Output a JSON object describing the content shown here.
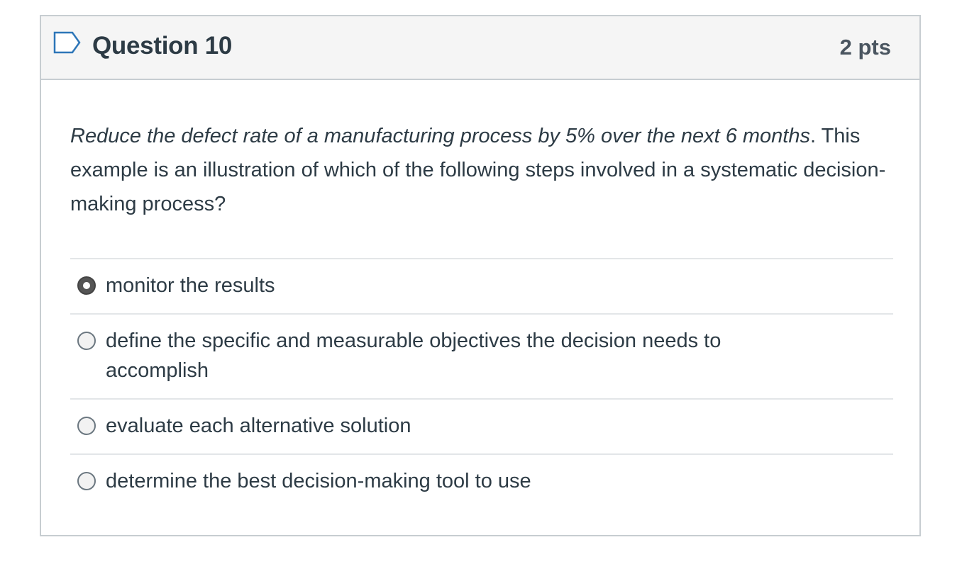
{
  "question": {
    "title": "Question 10",
    "points": "2 pts",
    "text_italic": "Reduce the defect rate of a manufacturing process by 5% over the next 6 months",
    "text_rest": ". This example is an illustration of which of the following steps involved in a systematic decision-making process?"
  },
  "icons": {
    "flag": "flag-outline-icon"
  },
  "colors": {
    "border": "#c7cdd1",
    "header_bg": "#f5f5f5",
    "text": "#2d3b45",
    "flag": "#2d76b8"
  },
  "answers": [
    {
      "label": "monitor the results",
      "selected": true
    },
    {
      "label": "define the specific and measurable objectives the decision needs to accomplish",
      "selected": false
    },
    {
      "label": "evaluate each alternative solution",
      "selected": false
    },
    {
      "label": "determine the best decision-making tool to use",
      "selected": false
    }
  ]
}
